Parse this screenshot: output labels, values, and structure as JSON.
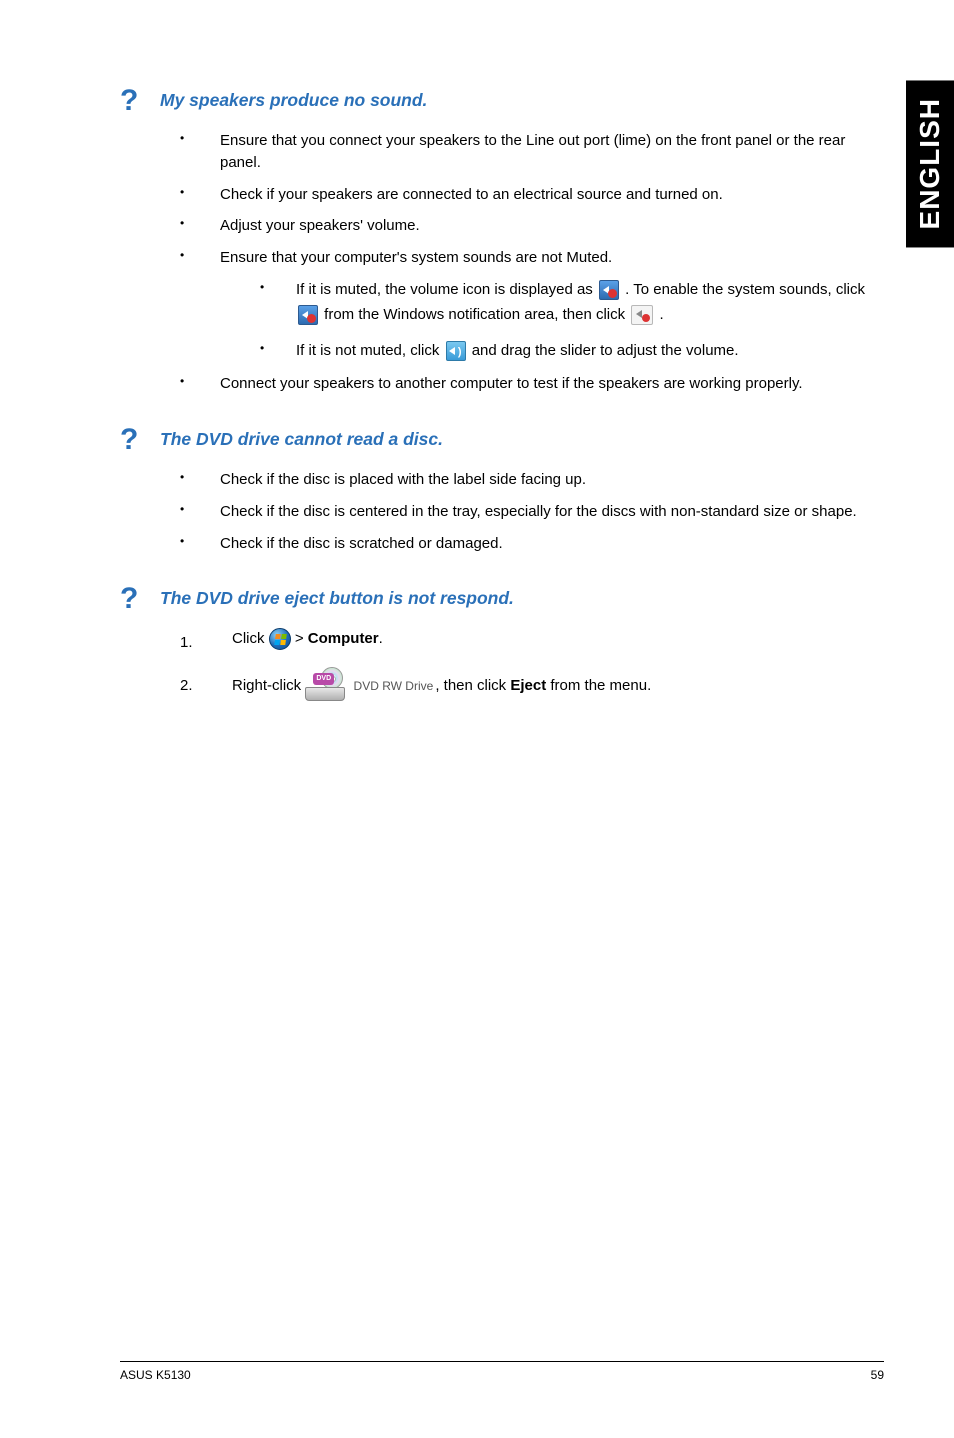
{
  "side_tab": "ENGLISH",
  "sections": [
    {
      "title": "My speakers produce no sound.",
      "bullets": [
        "Ensure that you connect your speakers to the Line out port (lime) on the front panel or the rear panel.",
        "Check if your speakers are connected to an electrical source and turned on.",
        "Adjust your speakers' volume.",
        "Ensure that your computer's system sounds are not Muted.",
        "Connect your speakers to another computer to test if the speakers are working properly."
      ],
      "sub": {
        "line1_a": "If it is muted, the volume icon is displayed as ",
        "line1_b": " . To enable the system sounds, click ",
        "line1_c": " from the Windows notification area, then click ",
        "line1_d": " .",
        "line2_a": "If it is not muted, click ",
        "line2_b": " and drag the slider to adjust the volume."
      }
    },
    {
      "title": "The DVD drive cannot read a disc.",
      "bullets": [
        "Check if the disc is placed with the label side facing up.",
        "Check if the disc is centered in the tray, especially for the discs with non-standard size or shape.",
        "Check if the disc is scratched or damaged."
      ]
    },
    {
      "title": "The DVD drive eject button is not respond.",
      "steps": {
        "n1": "1.",
        "s1_a": "Click ",
        "s1_b": " > ",
        "s1_c": "Computer",
        "s1_d": ".",
        "n2": "2.",
        "s2_a": "Right-click ",
        "s2_drive_badge": "DVD",
        "s2_drive_label": "DVD RW Drive",
        "s2_b": ", then click ",
        "s2_c": "Eject",
        "s2_d": " from the menu."
      }
    }
  ],
  "footer": {
    "left": "ASUS K5130",
    "right": "59"
  }
}
